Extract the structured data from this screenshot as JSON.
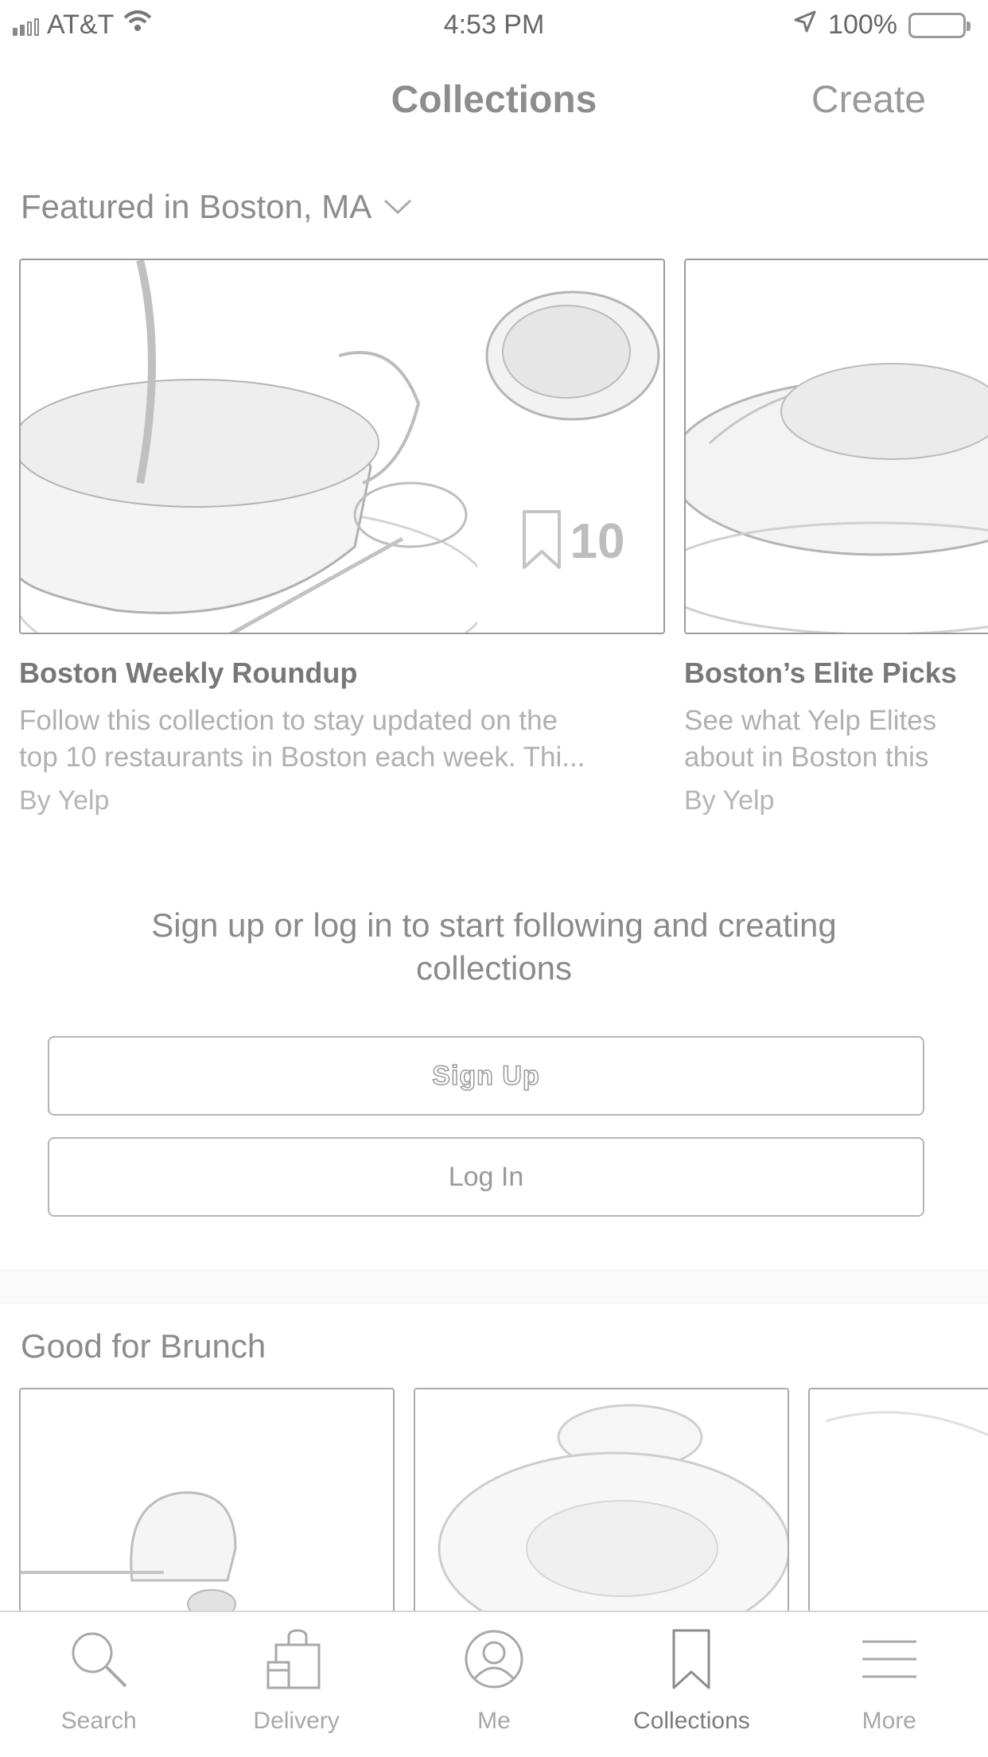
{
  "status_bar": {
    "carrier": "AT&T",
    "time": "4:53 PM",
    "battery": "100%"
  },
  "nav": {
    "title": "Collections",
    "create": "Create"
  },
  "featured": {
    "header": "Featured in Boston, MA",
    "cards": [
      {
        "title": "Boston Weekly Roundup",
        "desc_line1": "Follow this collection to stay updated on the",
        "desc_line2": "top 10 restaurants in Boston each week. Thi...",
        "by": "By Yelp",
        "count": "10"
      },
      {
        "title": "Boston’s Elite Picks",
        "desc_line1": "See what Yelp Elites",
        "desc_line2": "about in Boston this",
        "by": "By Yelp"
      }
    ]
  },
  "signup": {
    "message_line1": "Sign up or log in to start following and creating",
    "message_line2": "collections",
    "signup_label": "Sign Up",
    "login_label": "Log In"
  },
  "brunch": {
    "header": "Good for Brunch"
  },
  "tabs": [
    {
      "label": "Search",
      "icon": "search-icon"
    },
    {
      "label": "Delivery",
      "icon": "delivery-bag-icon"
    },
    {
      "label": "Me",
      "icon": "profile-icon"
    },
    {
      "label": "Collections",
      "icon": "bookmark-icon",
      "active": true
    },
    {
      "label": "More",
      "icon": "menu-icon"
    }
  ]
}
